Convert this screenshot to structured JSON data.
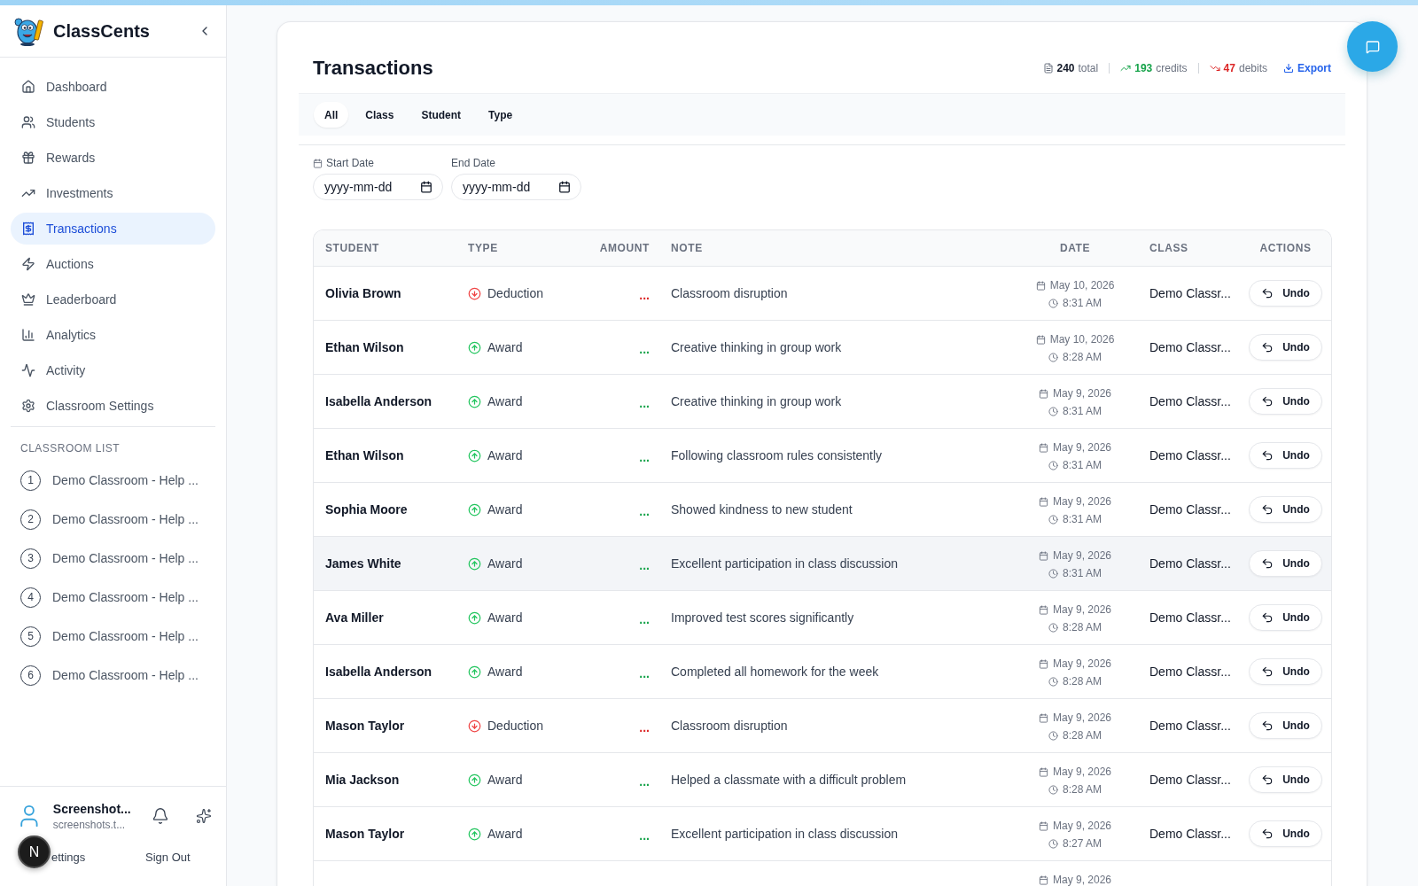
{
  "sidebar": {
    "brand": "ClassCents",
    "nav": [
      {
        "label": "Dashboard",
        "selected": false
      },
      {
        "label": "Students",
        "selected": false
      },
      {
        "label": "Rewards",
        "selected": false
      },
      {
        "label": "Investments",
        "selected": false
      },
      {
        "label": "Transactions",
        "selected": true
      },
      {
        "label": "Auctions",
        "selected": false
      },
      {
        "label": "Leaderboard",
        "selected": false
      },
      {
        "label": "Analytics",
        "selected": false
      },
      {
        "label": "Activity",
        "selected": false
      },
      {
        "label": "Classroom Settings",
        "selected": false
      }
    ],
    "section_title": "CLASSROOM LIST",
    "classrooms": [
      {
        "number": "1",
        "name": "Demo Classroom - Help ..."
      },
      {
        "number": "2",
        "name": "Demo Classroom - Help ..."
      },
      {
        "number": "3",
        "name": "Demo Classroom - Help ..."
      },
      {
        "number": "4",
        "name": "Demo Classroom - Help ..."
      },
      {
        "number": "5",
        "name": "Demo Classroom - Help ..."
      },
      {
        "number": "6",
        "name": "Demo Classroom - Help ..."
      }
    ],
    "user": {
      "name": "Screenshot...",
      "email": "screenshots.t..."
    },
    "links": [
      {
        "kind": "settings",
        "label": "ettings"
      },
      {
        "kind": "sign_out",
        "label": "Sign Out"
      }
    ]
  },
  "dev_badge": "N",
  "page": {
    "title": "Transactions",
    "stats": [
      {
        "kind": "total",
        "value": "240",
        "label": "total"
      },
      {
        "kind": "credits",
        "value": "193",
        "label": "credits"
      },
      {
        "kind": "debits",
        "value": "47",
        "label": "debits"
      }
    ],
    "export": "Export",
    "tabs": [
      {
        "label": "All",
        "selected": true
      },
      {
        "label": "Class",
        "selected": false
      },
      {
        "label": "Student",
        "selected": false
      },
      {
        "label": "Type",
        "selected": false
      }
    ],
    "filters": [
      {
        "kind": "start",
        "label": "Start Date",
        "placeholder": "yyyy-mm-dd"
      },
      {
        "kind": "end",
        "label": "End Date",
        "placeholder": "yyyy-mm-dd"
      }
    ]
  },
  "table": {
    "columns": [
      "STUDENT",
      "TYPE",
      "AMOUNT",
      "NOTE",
      "DATE",
      "CLASS",
      "ACTIONS"
    ],
    "rows": [
      {
        "student": "Olivia Brown",
        "type": {
          "kind": "deduction",
          "label": "Deduction"
        },
        "amount": "...",
        "note": "Classroom disruption",
        "date": "May 10, 2026",
        "time": "8:31 AM",
        "class": "Demo Classr...",
        "action": "Undo",
        "hovered": false
      },
      {
        "student": "Ethan Wilson",
        "type": {
          "kind": "award",
          "label": "Award"
        },
        "amount": "...",
        "note": "Creative thinking in group work",
        "date": "May 10, 2026",
        "time": "8:28 AM",
        "class": "Demo Classr...",
        "action": "Undo",
        "hovered": false
      },
      {
        "student": "Isabella Anderson",
        "type": {
          "kind": "award",
          "label": "Award"
        },
        "amount": "...",
        "note": "Creative thinking in group work",
        "date": "May 9, 2026",
        "time": "8:31 AM",
        "class": "Demo Classr...",
        "action": "Undo",
        "hovered": false
      },
      {
        "student": "Ethan Wilson",
        "type": {
          "kind": "award",
          "label": "Award"
        },
        "amount": "...",
        "note": "Following classroom rules consistently",
        "date": "May 9, 2026",
        "time": "8:31 AM",
        "class": "Demo Classr...",
        "action": "Undo",
        "hovered": false
      },
      {
        "student": "Sophia Moore",
        "type": {
          "kind": "award",
          "label": "Award"
        },
        "amount": "...",
        "note": "Showed kindness to new student",
        "date": "May 9, 2026",
        "time": "8:31 AM",
        "class": "Demo Classr...",
        "action": "Undo",
        "hovered": false
      },
      {
        "student": "James White",
        "type": {
          "kind": "award",
          "label": "Award"
        },
        "amount": "...",
        "note": "Excellent participation in class discussion",
        "date": "May 9, 2026",
        "time": "8:31 AM",
        "class": "Demo Classr...",
        "action": "Undo",
        "hovered": true
      },
      {
        "student": "Ava Miller",
        "type": {
          "kind": "award",
          "label": "Award"
        },
        "amount": "...",
        "note": "Improved test scores significantly",
        "date": "May 9, 2026",
        "time": "8:28 AM",
        "class": "Demo Classr...",
        "action": "Undo",
        "hovered": false
      },
      {
        "student": "Isabella Anderson",
        "type": {
          "kind": "award",
          "label": "Award"
        },
        "amount": "...",
        "note": "Completed all homework for the week",
        "date": "May 9, 2026",
        "time": "8:28 AM",
        "class": "Demo Classr...",
        "action": "Undo",
        "hovered": false
      },
      {
        "student": "Mason Taylor",
        "type": {
          "kind": "deduction",
          "label": "Deduction"
        },
        "amount": "...",
        "note": "Classroom disruption",
        "date": "May 9, 2026",
        "time": "8:28 AM",
        "class": "Demo Classr...",
        "action": "Undo",
        "hovered": false
      },
      {
        "student": "Mia Jackson",
        "type": {
          "kind": "award",
          "label": "Award"
        },
        "amount": "...",
        "note": "Helped a classmate with a difficult problem",
        "date": "May 9, 2026",
        "time": "8:28 AM",
        "class": "Demo Classr...",
        "action": "Undo",
        "hovered": false
      },
      {
        "student": "Mason Taylor",
        "type": {
          "kind": "award",
          "label": "Award"
        },
        "amount": "...",
        "note": "Excellent participation in class discussion",
        "date": "May 9, 2026",
        "time": "8:27 AM",
        "class": "Demo Classr...",
        "action": "Undo",
        "hovered": false
      },
      {
        "date": "May 9, 2026",
        "hovered": false
      }
    ]
  }
}
